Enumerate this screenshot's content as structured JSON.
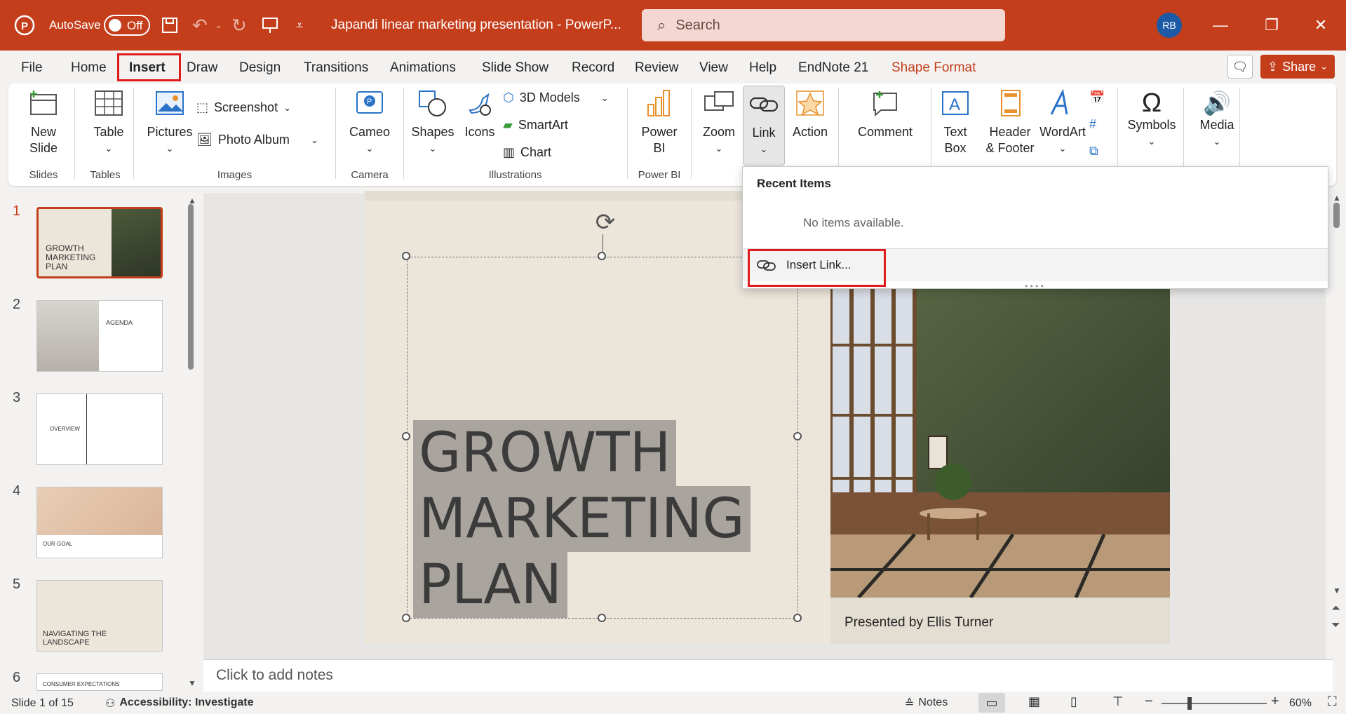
{
  "title_bar": {
    "autosave_label": "AutoSave",
    "autosave_state": "Off",
    "doc_title": "Japandi linear marketing presentation  -  PowerP...",
    "search_placeholder": "Search",
    "avatar": "RB"
  },
  "menu": {
    "tabs": [
      "File",
      "Home",
      "Insert",
      "Draw",
      "Design",
      "Transitions",
      "Animations",
      "Slide Show",
      "Record",
      "Review",
      "View",
      "Help",
      "EndNote 21",
      "Shape Format"
    ],
    "share": "Share"
  },
  "ribbon": {
    "new_slide": "New\nSlide",
    "table": "Table",
    "pictures": "Pictures",
    "screenshot": "Screenshot",
    "photo_album": "Photo Album",
    "cameo": "Cameo",
    "shapes": "Shapes",
    "icons": "Icons",
    "models": "3D Models",
    "smartart": "SmartArt",
    "chart": "Chart",
    "powerbi": "Power\nBI",
    "zoom": "Zoom",
    "link": "Link",
    "action": "Action",
    "comment": "Comment",
    "textbox": "Text\nBox",
    "header": "Header\n& Footer",
    "wordart": "WordArt",
    "symbols": "Symbols",
    "media": "Media",
    "groups": {
      "slides": "Slides",
      "tables": "Tables",
      "images": "Images",
      "camera": "Camera",
      "illustrations": "Illustrations",
      "powerbi": "Power BI"
    }
  },
  "dropdown": {
    "heading": "Recent Items",
    "empty": "No items available.",
    "insert_link": "Insert Link..."
  },
  "thumbnails": {
    "nums": [
      "1",
      "2",
      "3",
      "4",
      "5",
      "6"
    ],
    "t1": "GROWTH\nMARKETING\nPLAN",
    "t2": "AGENDA",
    "t3": "OVERVIEW",
    "t4": "OUR GOAL",
    "t5": "NAVIGATING THE\nLANDSCAPE",
    "t6": "CONSUMER EXPECTATIONS"
  },
  "slide": {
    "line1": "GROWTH",
    "line2": "MARKETING",
    "line3": "PLAN",
    "presenter": "Presented by Ellis Turner"
  },
  "notes_placeholder": "Click to add notes",
  "status": {
    "slide_count": "Slide 1 of 15",
    "accessibility": "Accessibility: Investigate",
    "notes": "Notes",
    "zoom": "60%"
  },
  "colors": {
    "brand": "#c43e1c",
    "highlight_box": "#e01b1b",
    "slide_bg": "#ebe5da"
  }
}
